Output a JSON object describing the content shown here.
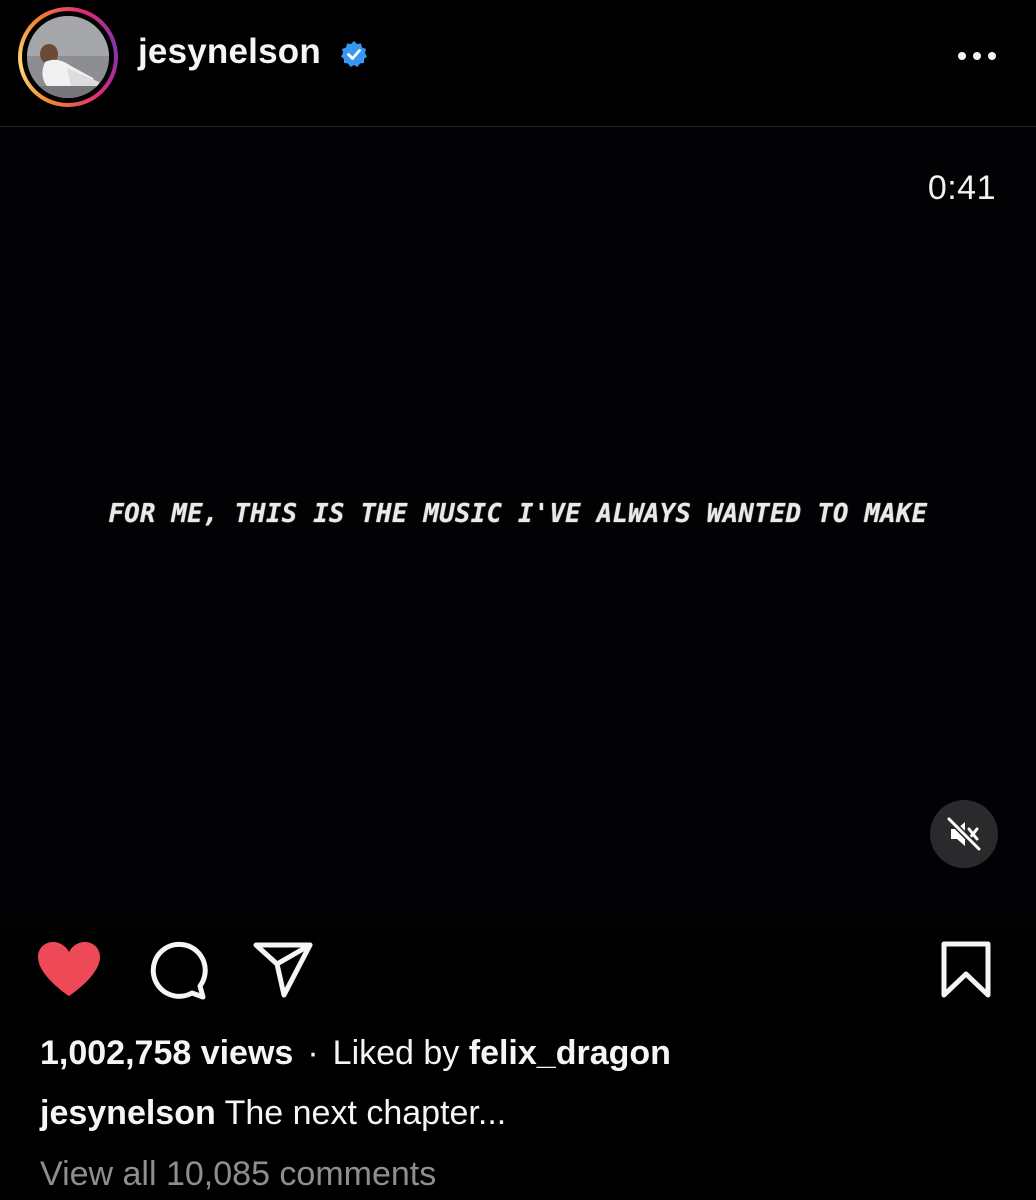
{
  "header": {
    "username": "jesynelson",
    "verified_color": "#3897f0"
  },
  "video": {
    "timer": "0:41",
    "overlay_text": "FOR ME, THIS IS THE MUSIC I'VE ALWAYS WANTED TO MAKE",
    "muted": true
  },
  "actions": {
    "liked": true,
    "like_color": "#ed4956",
    "icons": [
      "heart-icon",
      "comment-icon",
      "share-icon",
      "bookmark-icon"
    ]
  },
  "stats": {
    "views": "1,002,758 views",
    "separator": "·",
    "liked_by_prefix": "Liked by",
    "liked_by_user": "felix_dragon"
  },
  "caption": {
    "username": "jesynelson",
    "text": "The next chapter..."
  },
  "comments": {
    "view_all": "View all 10,085 comments"
  }
}
